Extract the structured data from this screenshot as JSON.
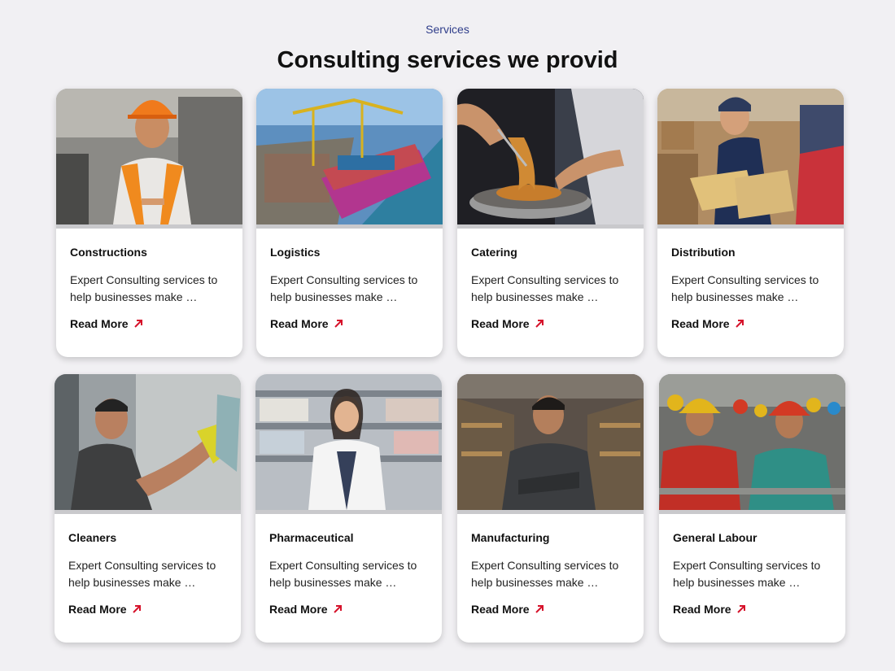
{
  "header": {
    "eyebrow": "Services",
    "title": "Consulting services we provid"
  },
  "colors": {
    "accent": "#d6122b",
    "eyebrow": "#2f3d8a",
    "background": "#f1f0f3"
  },
  "cards": [
    {
      "title": "Constructions",
      "description": "Expert Consulting services to help businesses make …",
      "link_label": "Read More",
      "image": "construction-worker-photo"
    },
    {
      "title": "Logistics",
      "description": "Expert Consulting services to help businesses make …",
      "link_label": "Read More",
      "image": "container-ship-photo"
    },
    {
      "title": "Catering",
      "description": "Expert Consulting services to help businesses make …",
      "link_label": "Read More",
      "image": "chef-cooking-photo"
    },
    {
      "title": "Distribution",
      "description": "Expert Consulting services to help businesses make …",
      "link_label": "Read More",
      "image": "warehouse-delivery-photo"
    },
    {
      "title": "Cleaners",
      "description": "Expert Consulting services to help businesses make …",
      "link_label": "Read More",
      "image": "window-cleaner-photo"
    },
    {
      "title": "Pharmaceutical",
      "description": "Expert Consulting services to help businesses make …",
      "link_label": "Read More",
      "image": "pharmacist-photo"
    },
    {
      "title": "Manufacturing",
      "description": "Expert Consulting services to help businesses make …",
      "link_label": "Read More",
      "image": "factory-worker-photo"
    },
    {
      "title": "General Labour",
      "description": "Expert Consulting services to help businesses make …",
      "link_label": "Read More",
      "image": "workers-group-photo"
    }
  ]
}
